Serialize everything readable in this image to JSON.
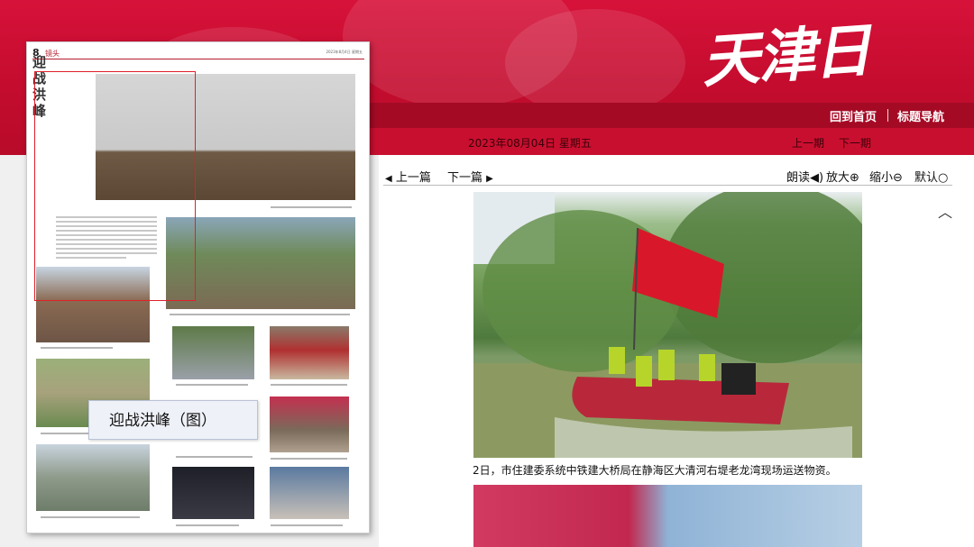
{
  "header": {
    "logo_text": "天津日報",
    "nav": [
      "回到首页",
      "标题导航"
    ],
    "date": "2023年08月04日  星期五",
    "issue_nav": [
      "上一期",
      "下一期"
    ]
  },
  "paper": {
    "page_number": "8",
    "section": "镜头",
    "meta": "2023年8月4日 星期五",
    "title": "迎战洪峰",
    "tooltip": "迎战洪峰（图）"
  },
  "toolbar": {
    "prev_article": "上一篇",
    "next_article": "下一篇",
    "read_aloud": "朗读",
    "zoom_in": "放大",
    "zoom_out": "缩小",
    "default": "默认"
  },
  "article": {
    "caption": "2日，市住建委系统中铁建大桥局在静海区大清河右堤老龙湾现场运送物资。"
  },
  "colors": {
    "brand_red": "#c40c2e",
    "dark_red": "#a50a25",
    "highlight": "#e0202a"
  }
}
